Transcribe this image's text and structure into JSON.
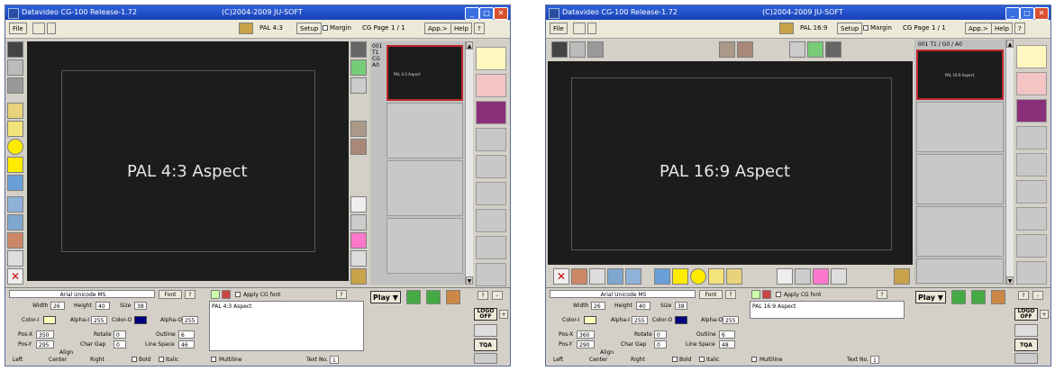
{
  "colors": {
    "accent": "#2e62d9",
    "close": "#d9502e",
    "canvas": "#1c1c1c",
    "selected": "#c0282c",
    "color_i": "#ffffc0",
    "color_o": "#000080"
  },
  "windows": [
    {
      "title": "Datavideo CG-100  Release-1.72",
      "copyright": "(C)2004-2009  JU-SOFT",
      "menu": {
        "file": "File",
        "pal": "PAL 4:3",
        "setup": "Setup",
        "margin": "Margin",
        "cgpage": "CG Page",
        "page": "1 / 1",
        "app": "App.>",
        "help": "Help",
        "q": "?"
      },
      "canvas_text": "PAL 4:3 Aspect",
      "pages_header": [
        "001",
        "T1",
        "CG",
        "A0"
      ],
      "thumb_text": "PAL 4:3 Aspect",
      "form": {
        "font": "Arial Unicode MS",
        "font_btn": "Font",
        "q": "?",
        "width_label": "Width",
        "width": "26",
        "height_label": "Height",
        "height": "40",
        "size_label": "Size",
        "size": "38",
        "colori_label": "Color-I",
        "alphai_label": "Alpha-I",
        "alphai": "255",
        "coloro_label": "Color-O",
        "alphao_label": "Alpha-O",
        "alphao": "255",
        "posx_label": "Pos-X",
        "posx": "350",
        "rotate_label": "Rotate",
        "rotate": "0",
        "outline_label": "Outline",
        "outline": "6",
        "posy_label": "Pos-Y",
        "posy": "295",
        "chargap_label": "Char Gap",
        "chargap": "0",
        "linespace_label": "Line Space",
        "linespace": "46",
        "align_label": "Align",
        "left": "Left",
        "center": "Center",
        "right": "Right",
        "bold": "Bold",
        "italic": "Italic",
        "apply": "Apply CG font",
        "text": "PAL 4:3 Aspect",
        "multiline": "Multiline",
        "textno": "Text No.",
        "textno_val": "1"
      },
      "play": "Play",
      "right": {
        "logo": "LOGO OFF",
        "tqa": "TQA",
        "q": "?",
        "minus": "-",
        "plus": "+"
      }
    },
    {
      "title": "Datavideo CG-100  Release-1.72",
      "copyright": "(C)2004-2009  JU-SOFT",
      "menu": {
        "file": "File",
        "pal": "PAL 16:9",
        "setup": "Setup",
        "margin": "Margin",
        "cgpage": "CG Page",
        "page": "1 / 1",
        "app": "App.>",
        "help": "Help",
        "q": "?"
      },
      "canvas_text": "PAL 16:9 Aspect",
      "pages_header": [
        "001  T1 / G0 / A0"
      ],
      "thumb_text": "PAL 16:9 Aspect",
      "form": {
        "font": "Arial Unicode MS",
        "font_btn": "Font",
        "q": "?",
        "width_label": "Width",
        "width": "26",
        "height_label": "Height",
        "height": "40",
        "size_label": "Size",
        "size": "38",
        "colori_label": "Color-I",
        "alphai_label": "Alpha-I",
        "alphai": "255",
        "coloro_label": "Color-O",
        "alphao_label": "Alpha-O",
        "alphao": "255",
        "posx_label": "Pos-X",
        "posx": "360",
        "rotate_label": "Rotate",
        "rotate": "0",
        "outline_label": "Outline",
        "outline": "6",
        "posy_label": "Pos-Y",
        "posy": "290",
        "chargap_label": "Char Gap",
        "chargap": "0",
        "linespace_label": "Line Space",
        "linespace": "48",
        "align_label": "Align",
        "left": "Left",
        "center": "Center",
        "right": "Right",
        "bold": "Bold",
        "italic": "Italic",
        "apply": "Apply CG font",
        "text": "PAL 16:9 Aspect",
        "multiline": "Multiline",
        "textno": "Text No.",
        "textno_val": "1"
      },
      "play": "Play",
      "right": {
        "logo": "LOGO OFF",
        "tqa": "TQA",
        "q": "?",
        "minus": "-",
        "plus": "+"
      }
    }
  ]
}
